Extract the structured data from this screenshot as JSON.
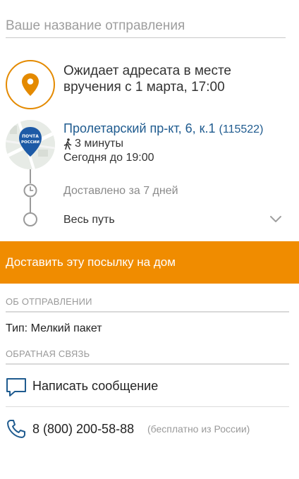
{
  "name_input": {
    "placeholder": "Ваше название отправления",
    "value": ""
  },
  "status": {
    "text": "Ожидает адресата в месте вручения с 1 марта, 17:00"
  },
  "office": {
    "logo_line1": "ПОЧТА",
    "logo_line2": "РОССИИ",
    "name": "Пролетарский пр-кт, 6, к.1",
    "zip": "(115522)",
    "walk_time": "3 минуты",
    "hours": "Сегодня до 19:00"
  },
  "timeline": {
    "delivered": "Доставлено за 7 дней",
    "full_route": "Весь путь"
  },
  "deliver_button": {
    "label": "Доставить эту посылку на дом"
  },
  "about": {
    "header": "ОБ ОТПРАВЛЕНИИ",
    "type": "Тип: Мелкий пакет"
  },
  "feedback": {
    "header": "ОБРАТНАЯ СВЯЗЬ",
    "message_label": "Написать сообщение",
    "phone": "8 (800) 200-58-88",
    "phone_note": "(бесплатно из России)"
  },
  "icons": {
    "status": "location-pin-icon",
    "walk": "walking-person-icon",
    "clock": "clock-icon",
    "expand": "chevron-down-icon",
    "message": "chat-bubble-icon",
    "phone": "phone-icon"
  },
  "colors": {
    "accent": "#f08c00",
    "pin": "#e48a00",
    "link": "#1f5b8f",
    "logo": "#1d5aa6",
    "muted": "#9a9a9a"
  }
}
